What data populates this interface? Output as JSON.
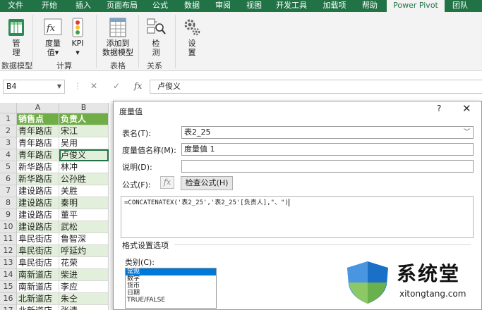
{
  "ribbon": {
    "tabs": [
      "文件",
      "开始",
      "插入",
      "页面布局",
      "公式",
      "数据",
      "审阅",
      "视图",
      "开发工具",
      "加载项",
      "帮助",
      "Power Pivot",
      "团队"
    ],
    "buttons": {
      "manage": "管\n理",
      "measure": "度量\n值▾",
      "kpi": "KPI\n▾",
      "add_to_model": "添加到\n数据模型",
      "detect": "检\n测",
      "settings": "设\n置"
    },
    "groups": [
      "数据模型",
      "计算",
      "表格",
      "关系"
    ]
  },
  "formula_bar": {
    "name_box": "B4",
    "fx_symbol": "fx",
    "content": "卢俊义"
  },
  "sheet": {
    "columns": [
      "A",
      "B"
    ],
    "rows": [
      {
        "num": "1",
        "a": "销售点",
        "b": "负责人"
      },
      {
        "num": "2",
        "a": "青年路店",
        "b": "宋江"
      },
      {
        "num": "3",
        "a": "青年路店",
        "b": "吴用"
      },
      {
        "num": "4",
        "a": "青年路店",
        "b": "卢俊义"
      },
      {
        "num": "5",
        "a": "新华路店",
        "b": "林冲"
      },
      {
        "num": "6",
        "a": "新华路店",
        "b": "公孙胜"
      },
      {
        "num": "7",
        "a": "建设路店",
        "b": "关胜"
      },
      {
        "num": "8",
        "a": "建设路店",
        "b": "秦明"
      },
      {
        "num": "9",
        "a": "建设路店",
        "b": "董平"
      },
      {
        "num": "10",
        "a": "建设路店",
        "b": "武松"
      },
      {
        "num": "11",
        "a": "阜民街店",
        "b": "鲁智深"
      },
      {
        "num": "12",
        "a": "阜民街店",
        "b": "呼延灼"
      },
      {
        "num": "13",
        "a": "阜民街店",
        "b": "花荣"
      },
      {
        "num": "14",
        "a": "南新道店",
        "b": "柴进"
      },
      {
        "num": "15",
        "a": "南新道店",
        "b": "李应"
      },
      {
        "num": "16",
        "a": "北新道店",
        "b": "朱仝"
      },
      {
        "num": "17",
        "a": "北新道店",
        "b": "张清"
      }
    ]
  },
  "dialog": {
    "title": "度量值",
    "help": "?",
    "close": "✕",
    "table_label": "表名(T):",
    "table_value": "表2_25",
    "measure_label": "度量值名称(M):",
    "measure_value": "度量值 1",
    "desc_label": "说明(D):",
    "desc_value": "",
    "formula_label": "公式(F):",
    "fx_button": "fx",
    "check_button": "检查公式(H)",
    "formula_text": "=CONCATENATEX('表2_25','表2_25'[负责人],\"、\")",
    "format_section": "格式设置选项",
    "category_label": "类别(C):",
    "categories": [
      "常规",
      "数字",
      "货币",
      "日期",
      "TRUE/FALSE"
    ],
    "selected_category": "常规"
  },
  "watermark": {
    "text": "系统堂",
    "url": "xitongtang.com",
    "colors": {
      "shield_blue": "#1a6fc7",
      "shield_green": "#6ab04c"
    }
  },
  "colors": {
    "accent": "#217346",
    "header_green": "#70ad47",
    "band_green": "#e2efda"
  }
}
